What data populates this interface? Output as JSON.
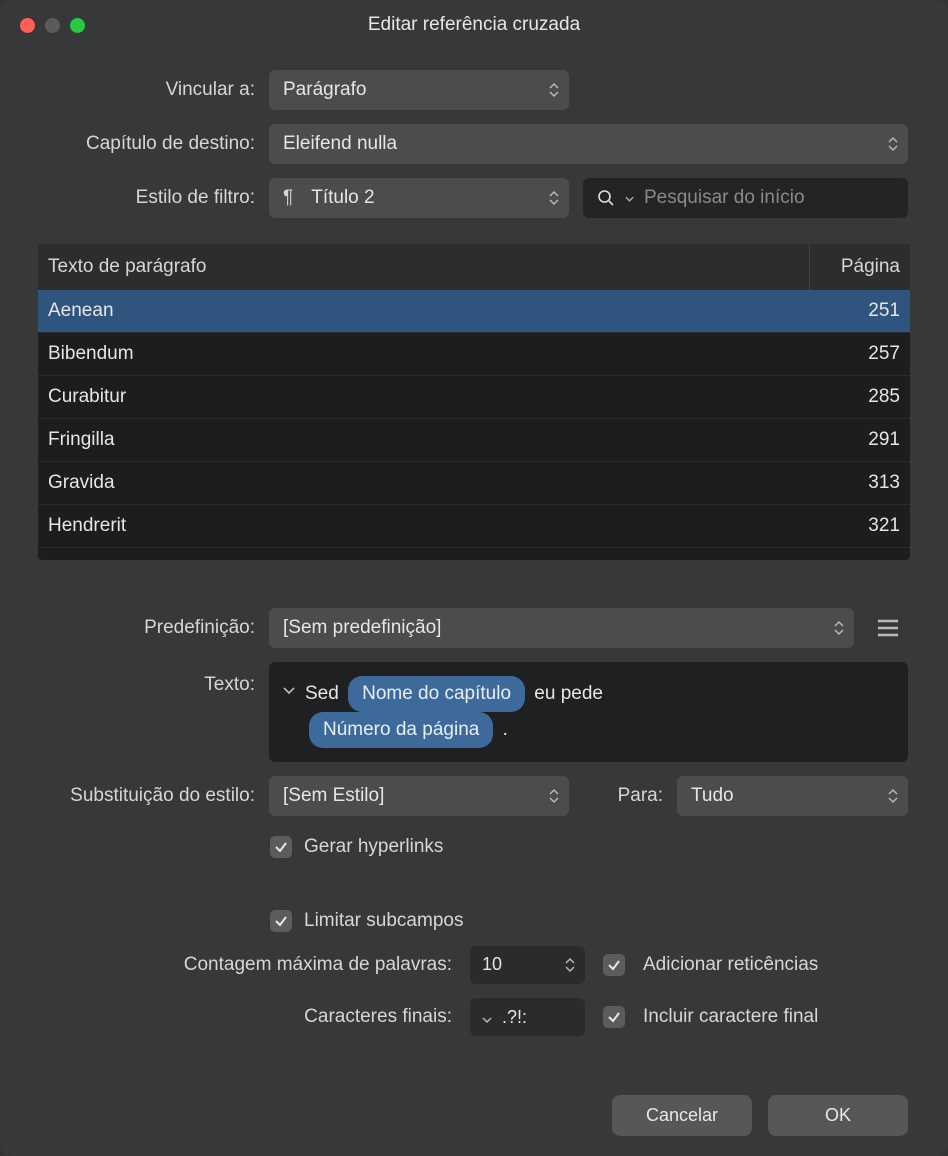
{
  "window": {
    "title": "Editar referência cruzada"
  },
  "labels": {
    "link_to": "Vincular a:",
    "dest_chapter": "Capítulo de destino:",
    "filter_style": "Estilo de filtro:",
    "preset": "Predefinição:",
    "text": "Texto:",
    "style_override": "Substituição do estilo:",
    "for": "Para:",
    "max_words": "Contagem máxima de palavras:",
    "end_chars": "Caracteres finais:"
  },
  "selects": {
    "link_to": "Parágrafo",
    "dest_chapter": "Eleifend nulla",
    "filter_style": "Título 2",
    "preset": "[Sem predefinição]",
    "style_override": "[Sem Estilo]",
    "for": "Tudo"
  },
  "search": {
    "placeholder": "Pesquisar do início"
  },
  "table": {
    "headers": {
      "text": "Texto de parágrafo",
      "page": "Página"
    },
    "rows": [
      {
        "text": "Aenean",
        "page": "251",
        "selected": true
      },
      {
        "text": "Bibendum",
        "page": "257",
        "selected": false
      },
      {
        "text": "Curabitur",
        "page": "285",
        "selected": false
      },
      {
        "text": "Fringilla",
        "page": "291",
        "selected": false
      },
      {
        "text": "Gravida",
        "page": "313",
        "selected": false
      },
      {
        "text": "Hendrerit",
        "page": "321",
        "selected": false
      }
    ]
  },
  "text_field": {
    "prefix": "Sed",
    "pill1": "Nome do capítulo",
    "mid": "eu pede",
    "pill2": "Número da página",
    "suffix": "."
  },
  "checkboxes": {
    "gen_hyperlinks": "Gerar hyperlinks",
    "limit_subfields": "Limitar subcampos",
    "add_ellipsis": "Adicionar reticências",
    "include_final": "Incluir caractere final"
  },
  "inputs": {
    "max_words": "10",
    "end_chars": ".?!:"
  },
  "buttons": {
    "cancel": "Cancelar",
    "ok": "OK"
  }
}
